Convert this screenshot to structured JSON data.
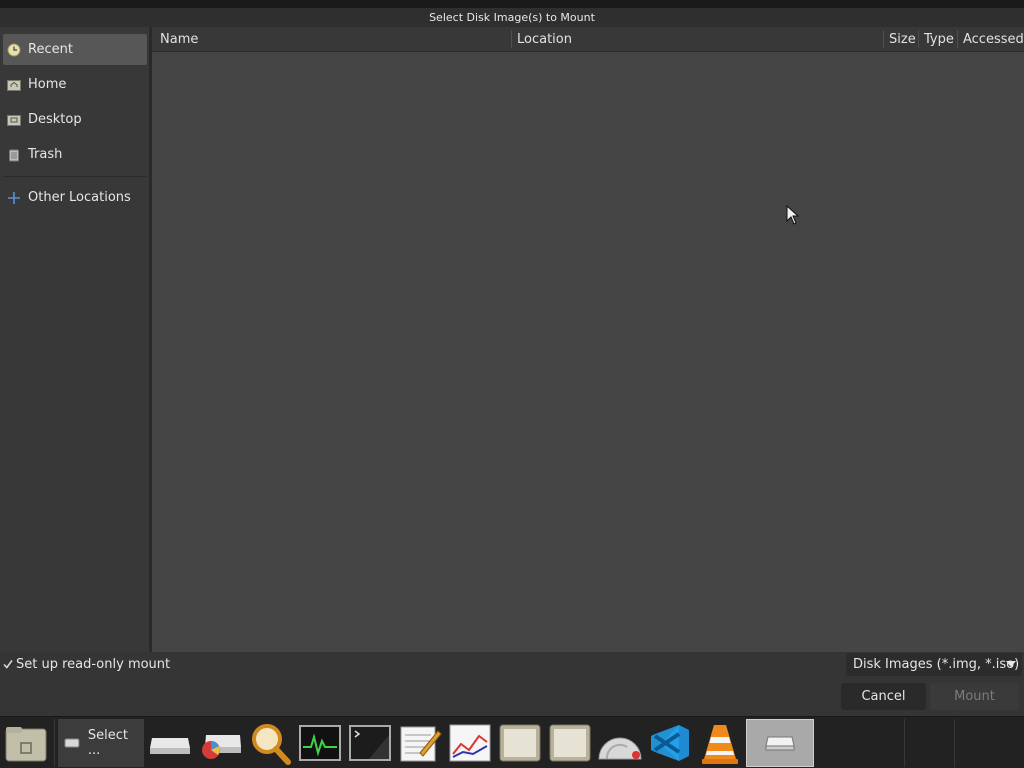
{
  "window": {
    "title": "Select Disk Image(s) to Mount"
  },
  "sidebar": {
    "items": [
      {
        "label": "Recent",
        "icon": "clock-icon",
        "active": true
      },
      {
        "label": "Home",
        "icon": "home-folder-icon"
      },
      {
        "label": "Desktop",
        "icon": "desktop-folder-icon"
      },
      {
        "label": "Trash",
        "icon": "trash-icon"
      }
    ],
    "other": {
      "label": "Other Locations",
      "icon": "plus-icon"
    }
  },
  "file_list": {
    "columns": [
      "Name",
      "Location",
      "Size",
      "Type",
      "Accessed"
    ],
    "rows": []
  },
  "options": {
    "readonly_label": "Set up read-only mount",
    "readonly_checked": true,
    "filter_label": "Disk Images (*.img, *.iso)"
  },
  "buttons": {
    "cancel": "Cancel",
    "mount": "Mount",
    "mount_enabled": false
  },
  "taskbar": {
    "active_window_label": "Select ...",
    "launchers": [
      "file-manager-icon",
      "disks-icon",
      "disk-usage-icon",
      "search-icon",
      "system-monitor-icon",
      "terminal-icon",
      "text-editor-icon",
      "chart-icon",
      "document-viewer-icon",
      "document-viewer-icon",
      "network-icon",
      "vscode-icon",
      "vlc-icon",
      "disk-image-mounter-icon"
    ]
  },
  "colors": {
    "background": "#454545",
    "sidebar": "#383838",
    "selected": "#575757",
    "text": "#e6e6e6"
  }
}
